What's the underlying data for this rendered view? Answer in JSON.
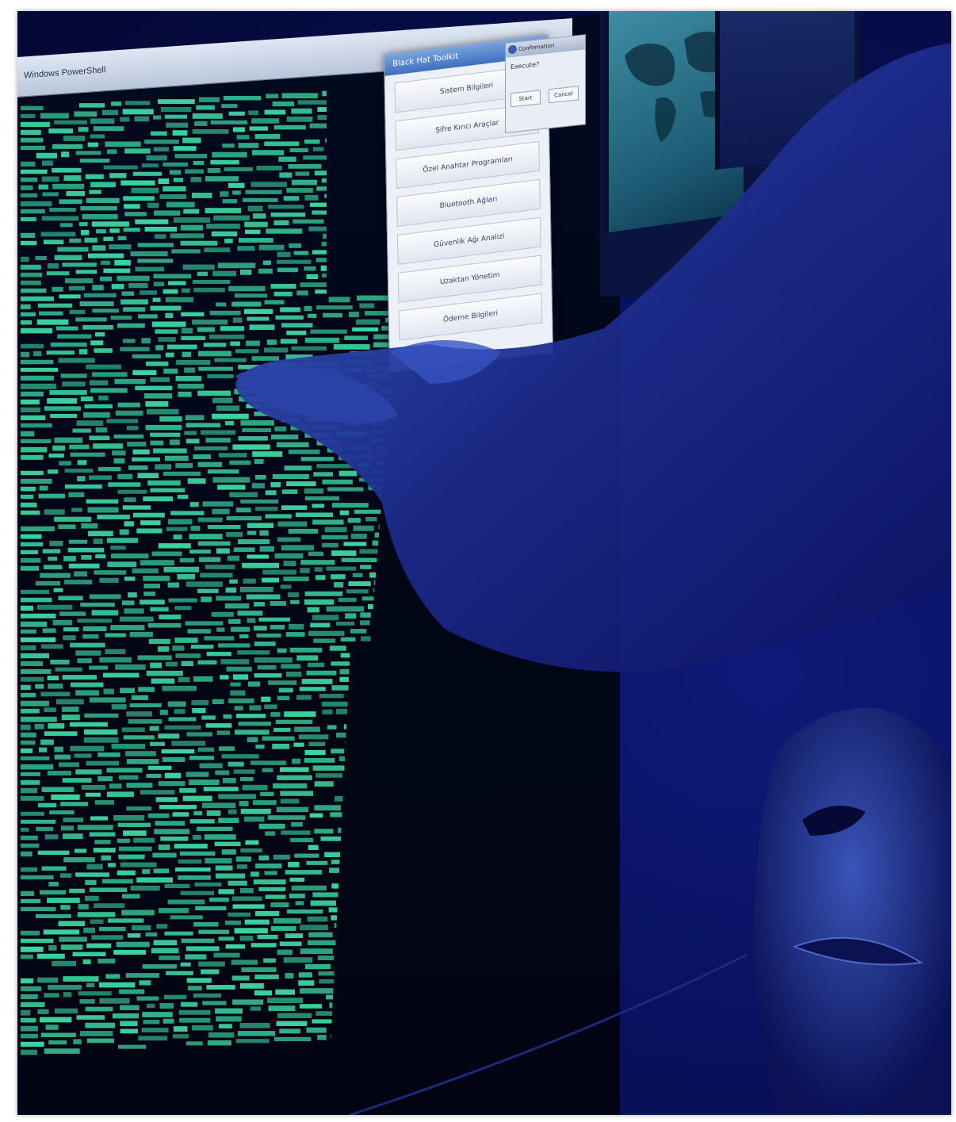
{
  "terminal": {
    "window_title": "Windows PowerShell"
  },
  "dialog": {
    "title": "Black Hat Toolkit",
    "close_glyph": "×",
    "buttons": [
      "Sistem Bilgileri",
      "Şifre Kırıcı Araçlar",
      "Özel Anahtar Programları",
      "Bluetooth Ağları",
      "Güvenlik Ağı Analizi",
      "Uzaktan Yönetim",
      "Ödeme Bilgileri"
    ]
  },
  "confirm": {
    "title": "Confirmation",
    "body": "Execute?",
    "ok": "Start",
    "cancel": "Cancel"
  },
  "colors": {
    "terminal_text": "#3fe0a6",
    "background": "#08105a",
    "arm": "#1c2a8a"
  }
}
